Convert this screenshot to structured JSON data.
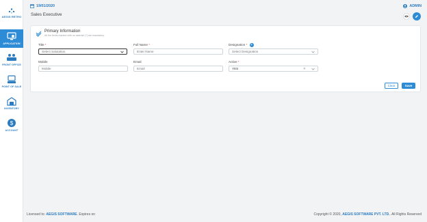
{
  "brand": {
    "name": "AEGIS RETRO"
  },
  "sidebar": {
    "items": [
      {
        "label": "APPLICATION",
        "icon": "monitor-gear-icon",
        "active": true
      },
      {
        "label": "FRONT OFFICE",
        "icon": "people-desk-icon",
        "active": false
      },
      {
        "label": "POINT OF SALE",
        "icon": "pos-terminal-icon",
        "active": false
      },
      {
        "label": "INVENTORY",
        "icon": "warehouse-icon",
        "active": false
      },
      {
        "label": "ACCOUNT",
        "icon": "money-bag-icon",
        "active": false
      }
    ]
  },
  "header": {
    "date": "19/01/2020",
    "user": "ADMIN",
    "page_title": "Sales Executive"
  },
  "form": {
    "title": "Primary Information",
    "subtitle": "All the fields marked with an asterisk (*) are mandatory.",
    "fields": {
      "title": {
        "label": "Title",
        "required": "*",
        "value": "Select Salutation"
      },
      "full_name": {
        "label": "Full Name",
        "required": "*",
        "placeholder": "Enter Name"
      },
      "designation": {
        "label": "Designation",
        "required": "*",
        "value": "Select Designation"
      },
      "mobile": {
        "label": "Mobile",
        "placeholder": "Mobile"
      },
      "email": {
        "label": "Email",
        "placeholder": "Email"
      },
      "active": {
        "label": "Active",
        "required": "*",
        "value": "YES"
      }
    },
    "buttons": {
      "clear": "Clear",
      "save": "Save"
    }
  },
  "footer": {
    "licensed_prefix": "Licensed to:",
    "licensee": "AEGIS SOFTWARE",
    "expires": ". Expires on",
    "copyright_prefix": "Copyright © 2020,",
    "company": "AEGIS SOFTWARE PVT. LTD.",
    "rights": ". All Rights Reserved"
  },
  "colors": {
    "accent": "#2e8bd6",
    "required": "#e0453a"
  }
}
